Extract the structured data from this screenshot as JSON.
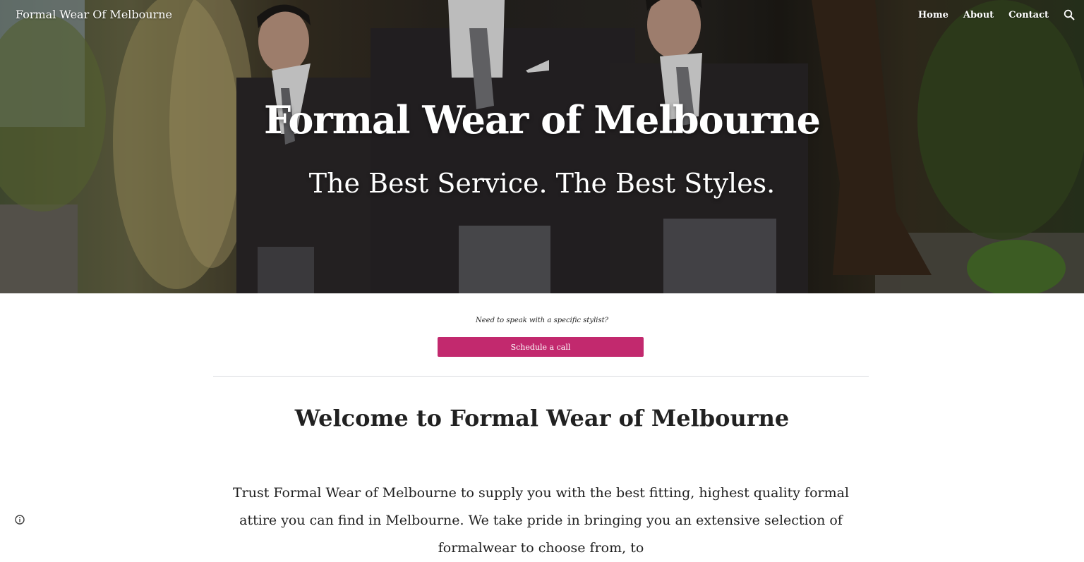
{
  "header": {
    "site_title": "Formal Wear Of Melbourne",
    "nav": [
      "Home",
      "About",
      "Contact"
    ],
    "search_icon": "search-icon"
  },
  "hero": {
    "heading": "Formal Wear of Melbourne",
    "subheading": "The Best Service. The Best Styles.",
    "image": "three men in dark morning suits with striped ties walking outdoors"
  },
  "cta": {
    "prompt": "Need to speak with a specific stylist?",
    "button_label": "Schedule a call"
  },
  "welcome": {
    "heading": "Welcome to Formal Wear of Melbourne",
    "paragraph": "Trust Formal Wear of Melbourne to supply you with the best fitting, highest quality formal attire you can find in Melbourne. We take pride in bringing you an extensive selection of formalwear to choose from, to"
  },
  "footer": {
    "info_icon": "info-icon"
  },
  "colors": {
    "accent": "#c2296e",
    "text": "#212121",
    "divider": "#dadce0"
  }
}
